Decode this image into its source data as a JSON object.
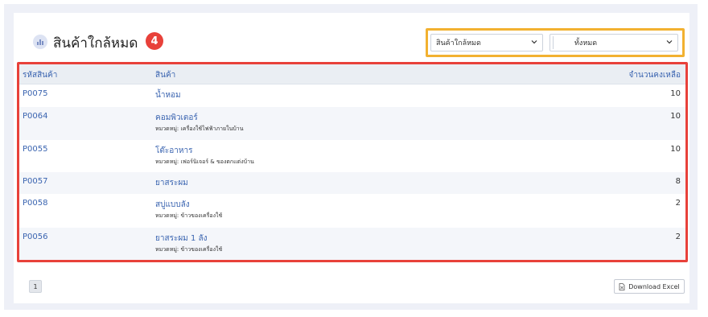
{
  "header": {
    "title": "สินค้าใกล้หมด",
    "badge": "4",
    "icon": "chart-icon"
  },
  "filters": {
    "status_select": "สินค้าใกล้หมด",
    "category_select": "ทั้งหมด"
  },
  "table": {
    "columns": [
      "รหัสสินค้า",
      "สินค้า",
      "จำนวนคงเหลือ"
    ],
    "rows": [
      {
        "code": "P0075",
        "name": "น้ำหอม",
        "category": "",
        "qty": "10"
      },
      {
        "code": "P0064",
        "name": "คอมพิวเตอร์",
        "category": "หมวดหมู่: เครื่องใช้ไฟฟ้าภายในบ้าน",
        "qty": "10"
      },
      {
        "code": "P0055",
        "name": "โต๊ะอาหาร",
        "category": "หมวดหมู่: เฟอร์นิเจอร์ & ของตกแต่งบ้าน",
        "qty": "10"
      },
      {
        "code": "P0057",
        "name": "ยาสระผม",
        "category": "",
        "qty": "8"
      },
      {
        "code": "P0058",
        "name": "สบู่แบบลัง",
        "category": "หมวดหมู่: ข้าวของเครื่องใช้",
        "qty": "2"
      },
      {
        "code": "P0056",
        "name": "ยาสระผม 1 ลัง",
        "category": "หมวดหมู่: ข้าวของเครื่องใช้",
        "qty": "2"
      }
    ]
  },
  "pagination": {
    "current_page": "1"
  },
  "actions": {
    "download_label": "Download Excel"
  },
  "colors": {
    "accent_blue": "#3a64b0",
    "highlight_red": "#e8413a",
    "highlight_orange": "#f2b130"
  }
}
